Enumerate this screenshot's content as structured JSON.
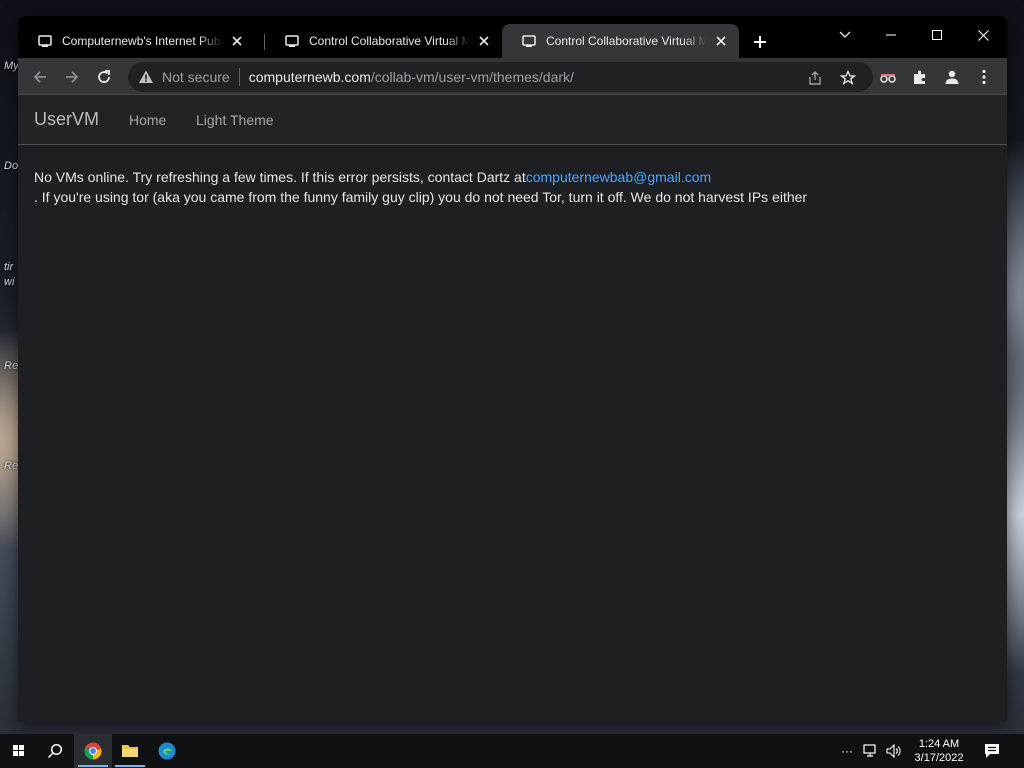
{
  "desktop": {
    "icon_labels": [
      "My",
      "Do",
      "tir",
      "wi",
      "Re",
      "Re"
    ]
  },
  "browser": {
    "tabs": [
      {
        "label": "Computernewb's Internet Pub H",
        "active": false
      },
      {
        "label": "Control Collaborative Virtual Ma",
        "active": false
      },
      {
        "label": "Control Collaborative Virtual Ma",
        "active": true
      }
    ],
    "omnibox": {
      "security_label": "Not secure",
      "host": "computernewb.com",
      "path": "/collab-vm/user-vm/themes/dark/"
    }
  },
  "page": {
    "navbar": {
      "brand": "UserVM",
      "links": [
        "Home",
        "Light Theme"
      ]
    },
    "message": {
      "line1_prefix": "No VMs online. Try refreshing a few times. If this error persists, contact Dartz at",
      "email": "computernewbab@gmail.com",
      "line2": ". If you're using tor (aka you came from the funny family guy clip) you do not need Tor, turn it off. We do not harvest IPs either"
    }
  },
  "taskbar": {
    "time": "1:24 AM",
    "date": "3/17/2022"
  },
  "colors": {
    "link": "#4da3ff",
    "page_bg": "#1e1f22"
  }
}
